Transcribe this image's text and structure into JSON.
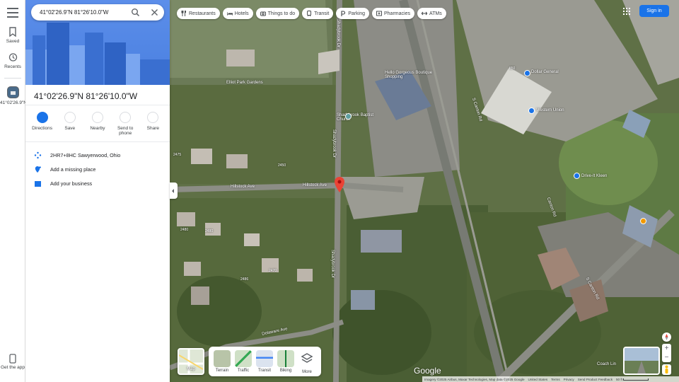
{
  "search": {
    "query": "41°02'26.9\"N 81°26'10.0\"W"
  },
  "rail": {
    "saved": "Saved",
    "recents": "Recents",
    "place_label": "41°02'26.9\"N",
    "get_app": "Get the app"
  },
  "place": {
    "title": "41°02'26.9\"N 81°26'10.0\"W",
    "actions": [
      {
        "label": "Directions"
      },
      {
        "label": "Save"
      },
      {
        "label": "Nearby"
      },
      {
        "label": "Send to phone"
      },
      {
        "label": "Share"
      }
    ],
    "info": [
      {
        "text": "2HR7+8HC Sawyerwood, Ohio",
        "icon": "plus-code-icon"
      },
      {
        "text": "Add a missing place",
        "icon": "add-place-icon"
      },
      {
        "text": "Add your business",
        "icon": "business-icon"
      }
    ]
  },
  "chips": [
    {
      "label": "Restaurants",
      "icon": "restaurant-icon"
    },
    {
      "label": "Hotels",
      "icon": "hotel-icon"
    },
    {
      "label": "Things to do",
      "icon": "camera-icon"
    },
    {
      "label": "Transit",
      "icon": "train-icon"
    },
    {
      "label": "Parking",
      "icon": "parking-icon"
    },
    {
      "label": "Pharmacies",
      "icon": "pharmacy-icon"
    },
    {
      "label": "ATMs",
      "icon": "atm-icon"
    }
  ],
  "header": {
    "sign_in": "Sign in"
  },
  "map_labels": {
    "road_sc1": "S Canton Rd",
    "road_sc2": "S Canton Rd",
    "road_canton": "Canton Rd",
    "road_hillstock_w": "Hillstock Ave",
    "road_hillstock_e": "Hillstock Ave",
    "road_delaware": "Delaware Ave",
    "road_shady1": "Shadybrook Dr",
    "road_shady2": "Shadybrook Dr",
    "road_shady3": "Shadybrook Dr",
    "poi_hello": "Hello Gorgeous Boutique Shopping",
    "poi_elliot": "Elliot Park Gardens",
    "poi_baptist": "Shadybrook Baptist Church",
    "poi_dollar": "Dollar General",
    "poi_western": "Western Union",
    "poi_drive": "Drive-It Kleen",
    "poi_coach": "Coach Lin",
    "addr_1": "2475",
    "addr_2": "2450",
    "addr_3": "2486",
    "addr_4": "2480",
    "addr_5": "2470",
    "addr_6": "850",
    "addr_7": "2480"
  },
  "layers": {
    "current": "Map",
    "options": [
      "Terrain",
      "Traffic",
      "Transit",
      "Biking",
      "More"
    ]
  },
  "footer": {
    "google": "Google",
    "imagery": "Imagery ©2025 Airbus, Maxar Technologies, Map data ©2025 Google",
    "region": "United States",
    "terms": "Terms",
    "privacy": "Privacy",
    "feedback": "Send Product Feedback",
    "scale": "50 ft"
  },
  "colors": {
    "accent": "#1a73e8",
    "pin": "#ea4335",
    "hero": "#4f86e5"
  }
}
